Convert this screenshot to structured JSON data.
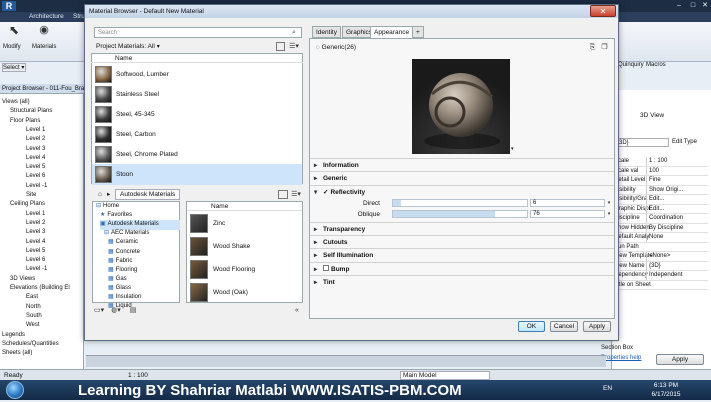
{
  "app": {
    "tabs": [
      "Architecture",
      "Structure"
    ],
    "right_tabs": [
      "Quinquiry",
      "Macros"
    ],
    "ribbon_labels": [
      "Modify",
      "Materials"
    ],
    "select_label": "Select ▾"
  },
  "project_browser": {
    "title": "Project Browser - 011-Fou_Bra...",
    "items": [
      "Views (all)",
      "Structural Plans",
      "Floor Plans",
      "Level 1",
      "Level 2",
      "Level 3",
      "Level 4",
      "Level 5",
      "Level 6",
      "Level -1",
      "Site",
      "Ceiling Plans",
      "Level 1",
      "Level 2",
      "Level 3",
      "Level 4",
      "Level 5",
      "Level 6",
      "Level -1",
      "3D Views",
      "Elevations (Building El",
      "East",
      "North",
      "South",
      "West",
      "Legends",
      "Schedules/Quantities",
      "Sheets (all)"
    ]
  },
  "dialog": {
    "title": "Material Browser - Default New Material",
    "close": "✕",
    "search_placeholder": "Search",
    "project_materials_label": "Project Materials: All",
    "list_header": "Name",
    "materials": [
      {
        "name": "Softwood, Lumber",
        "color": "#8a6a45"
      },
      {
        "name": "Stainless Steel",
        "color": "#4a4a4a"
      },
      {
        "name": "Steel, 45-345",
        "color": "#3c3c3c"
      },
      {
        "name": "Steel, Carbon",
        "color": "#2f2f2f"
      },
      {
        "name": "Steel, Chrome Plated",
        "color": "#5a5a5a"
      },
      {
        "name": "Stoon",
        "color": "#6a5f52"
      }
    ],
    "library_breadcrumb": "Autodesk Materials",
    "library_tree": [
      "Home",
      "Favorites",
      "Autodesk Materials",
      "AEC Materials",
      "Ceramic",
      "Concrete",
      "Fabric",
      "Flooring",
      "Gas",
      "Glass",
      "Insulation",
      "Liquid"
    ],
    "library_header": "Name",
    "library_items": [
      {
        "name": "Zinc",
        "color": "#555"
      },
      {
        "name": "Wood Shake",
        "color": "#6b5238"
      },
      {
        "name": "Wood Flooring",
        "color": "#7a5a3a"
      },
      {
        "name": "Wood (Oak)",
        "color": "#8a6a44"
      }
    ],
    "editor_tabs": [
      "Identity",
      "Graphics",
      "Appearance",
      "+"
    ],
    "asset_name": "Generic(26)",
    "sections": [
      "Information",
      "Generic",
      "Reflectivity",
      "Transparency",
      "Cutouts",
      "Self Illumination",
      "Bump",
      "Tint"
    ],
    "reflectivity": {
      "direct_label": "Direct",
      "direct_value": "6",
      "direct_fraction": 0.06,
      "oblique_label": "Oblique",
      "oblique_value": "76",
      "oblique_fraction": 0.76
    },
    "buttons": {
      "ok": "OK",
      "cancel": "Cancel",
      "apply": "Apply"
    }
  },
  "properties": {
    "view_name": "3D View",
    "type_select": "{3D}",
    "edit_type": "Edit Type",
    "rows": [
      {
        "k": "Scale",
        "v": "1 : 100"
      },
      {
        "k": "Scale val",
        "v": "100"
      },
      {
        "k": "Detail Level",
        "v": "Fine"
      },
      {
        "k": "Visibility",
        "v": "Show Origi..."
      },
      {
        "k": "Visibility/Gra",
        "v": "Edit..."
      },
      {
        "k": "Graphic Displ",
        "v": "Edit..."
      },
      {
        "k": "Discipline",
        "v": "Coordination"
      },
      {
        "k": "Show Hidden",
        "v": "By Discipline"
      },
      {
        "k": "Default Analy",
        "v": "None"
      },
      {
        "k": "Sun Path",
        "v": ""
      },
      {
        "k": "View Template",
        "v": "<None>"
      },
      {
        "k": "View Name",
        "v": "{3D}"
      },
      {
        "k": "Dependency",
        "v": "Independent"
      },
      {
        "k": "Title on Sheet",
        "v": ""
      }
    ],
    "section_box": "Section Box",
    "help_link": "Properties help",
    "apply": "Apply"
  },
  "status": {
    "ready": "Ready",
    "scale": "1 : 100",
    "model": "Main Model"
  },
  "taskbar": {
    "watermark": "Learning BY Shahriar Matlabi      WWW.ISATIS-PBM.COM",
    "lang": "EN",
    "time": "6:13 PM",
    "date": "6/17/2015"
  },
  "colors": {
    "accent": "#3c7fb1",
    "title": "#1c2d44",
    "selected": "#cde4fb"
  }
}
